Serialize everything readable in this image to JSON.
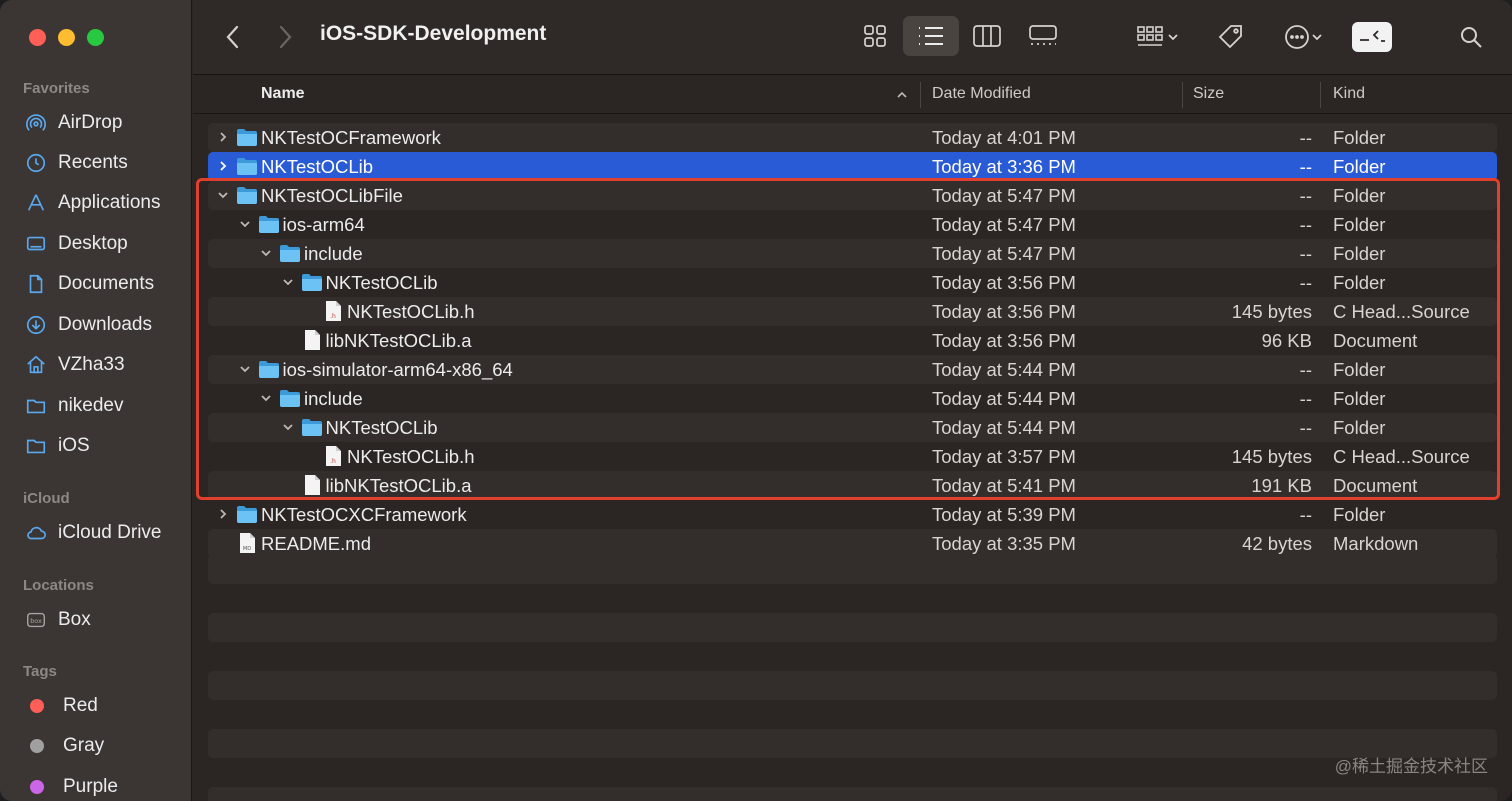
{
  "window": {
    "title": "iOS-SDK-Development"
  },
  "sidebar": {
    "favorites_label": "Favorites",
    "favorites": [
      {
        "label": "AirDrop",
        "icon": "airdrop-icon"
      },
      {
        "label": "Recents",
        "icon": "clock-icon"
      },
      {
        "label": "Applications",
        "icon": "applications-icon"
      },
      {
        "label": "Desktop",
        "icon": "desktop-icon"
      },
      {
        "label": "Documents",
        "icon": "document-icon"
      },
      {
        "label": "Downloads",
        "icon": "download-icon"
      },
      {
        "label": "VZha33",
        "icon": "home-icon"
      },
      {
        "label": "nikedev",
        "icon": "folder-icon"
      },
      {
        "label": "iOS",
        "icon": "folder-icon"
      }
    ],
    "icloud_label": "iCloud",
    "icloud": [
      {
        "label": "iCloud Drive",
        "icon": "cloud-icon"
      }
    ],
    "locations_label": "Locations",
    "locations": [
      {
        "label": "Box",
        "icon": "box-icon"
      }
    ],
    "tags_label": "Tags",
    "tags": [
      {
        "label": "Red",
        "color": "#ff5f57"
      },
      {
        "label": "Gray",
        "color": "#a0a0a0"
      },
      {
        "label": "Purple",
        "color": "#cc66e8"
      }
    ]
  },
  "columns": {
    "name": "Name",
    "date": "Date Modified",
    "size": "Size",
    "kind": "Kind"
  },
  "rows": [
    {
      "name": "NKTestOCFramework",
      "date": "Today at 4:01 PM",
      "size": "--",
      "kind": "Folder",
      "type": "folder",
      "level": 0,
      "disclosure": "collapsed",
      "selected": false
    },
    {
      "name": "NKTestOCLib",
      "date": "Today at 3:36 PM",
      "size": "--",
      "kind": "Folder",
      "type": "folder",
      "level": 0,
      "disclosure": "collapsed",
      "selected": true
    },
    {
      "name": "NKTestOCLibFile",
      "date": "Today at 5:47 PM",
      "size": "--",
      "kind": "Folder",
      "type": "folder",
      "level": 0,
      "disclosure": "expanded",
      "selected": false
    },
    {
      "name": "ios-arm64",
      "date": "Today at 5:47 PM",
      "size": "--",
      "kind": "Folder",
      "type": "folder",
      "level": 1,
      "disclosure": "expanded",
      "selected": false
    },
    {
      "name": "include",
      "date": "Today at 5:47 PM",
      "size": "--",
      "kind": "Folder",
      "type": "folder",
      "level": 2,
      "disclosure": "expanded",
      "selected": false
    },
    {
      "name": "NKTestOCLib",
      "date": "Today at 3:56 PM",
      "size": "--",
      "kind": "Folder",
      "type": "folder",
      "level": 3,
      "disclosure": "expanded",
      "selected": false
    },
    {
      "name": "NKTestOCLib.h",
      "date": "Today at 3:56 PM",
      "size": "145 bytes",
      "kind": "C Head...Source",
      "type": "header",
      "level": 4,
      "disclosure": "none",
      "selected": false
    },
    {
      "name": "libNKTestOCLib.a",
      "date": "Today at 3:56 PM",
      "size": "96 KB",
      "kind": "Document",
      "type": "doc",
      "level": 3,
      "disclosure": "none",
      "selected": false
    },
    {
      "name": "ios-simulator-arm64-x86_64",
      "date": "Today at 5:44 PM",
      "size": "--",
      "kind": "Folder",
      "type": "folder",
      "level": 1,
      "disclosure": "expanded",
      "selected": false
    },
    {
      "name": "include",
      "date": "Today at 5:44 PM",
      "size": "--",
      "kind": "Folder",
      "type": "folder",
      "level": 2,
      "disclosure": "expanded",
      "selected": false
    },
    {
      "name": "NKTestOCLib",
      "date": "Today at 5:44 PM",
      "size": "--",
      "kind": "Folder",
      "type": "folder",
      "level": 3,
      "disclosure": "expanded",
      "selected": false
    },
    {
      "name": "NKTestOCLib.h",
      "date": "Today at 3:57 PM",
      "size": "145 bytes",
      "kind": "C Head...Source",
      "type": "header",
      "level": 4,
      "disclosure": "none",
      "selected": false
    },
    {
      "name": "libNKTestOCLib.a",
      "date": "Today at 5:41 PM",
      "size": "191 KB",
      "kind": "Document",
      "type": "doc",
      "level": 3,
      "disclosure": "none",
      "selected": false
    },
    {
      "name": "NKTestOCXCFramework",
      "date": "Today at 5:39 PM",
      "size": "--",
      "kind": "Folder",
      "type": "folder",
      "level": 0,
      "disclosure": "collapsed",
      "selected": false
    },
    {
      "name": "README.md",
      "date": "Today at 3:35 PM",
      "size": "42 bytes",
      "kind": "Markdown",
      "type": "md",
      "level": 0,
      "disclosure": "none",
      "selected": false
    }
  ],
  "watermark": "@稀土掘金技术社区",
  "colors": {
    "selection": "#2a5bd7",
    "highlight_border": "#e2402f",
    "folder": "#5ab4f0"
  }
}
